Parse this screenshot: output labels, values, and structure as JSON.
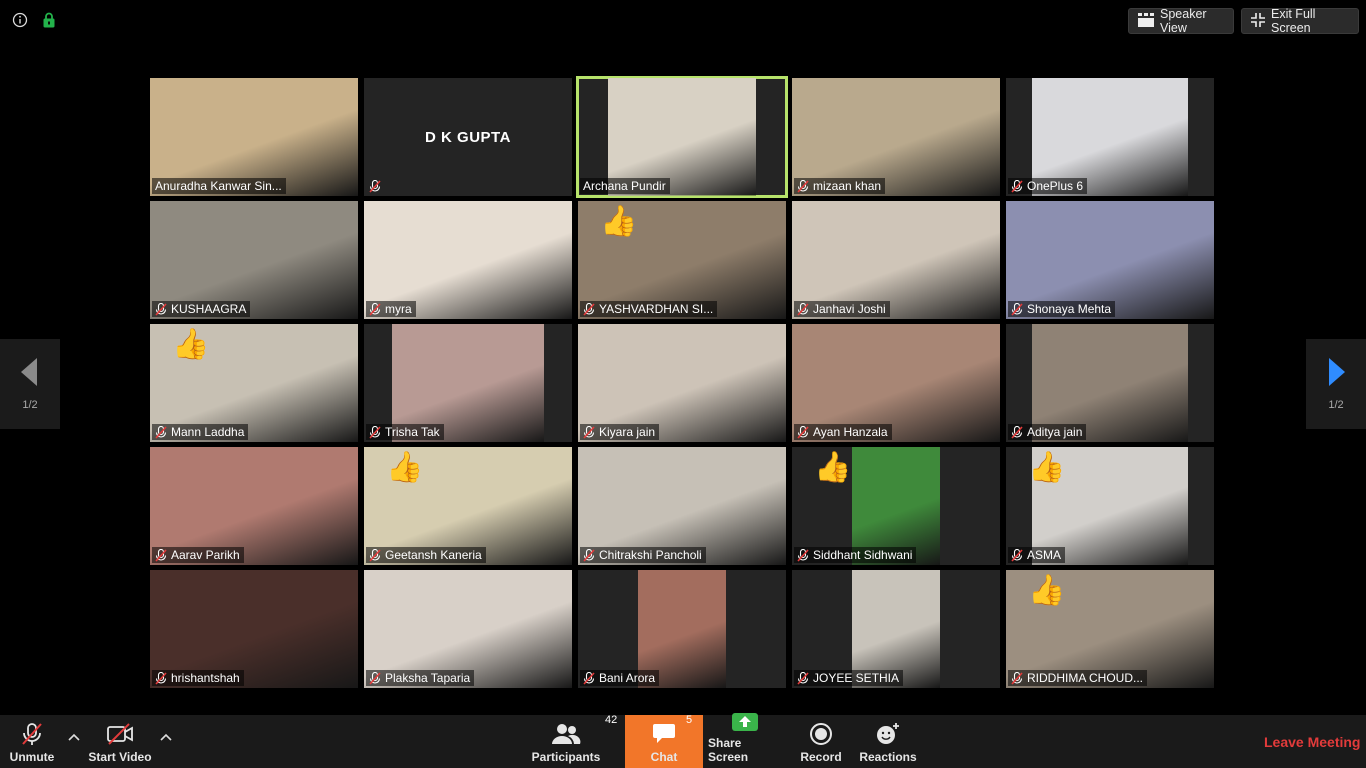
{
  "top": {
    "speaker_view": "Speaker View",
    "exit_full_screen": "Exit Full Screen"
  },
  "participants": [
    {
      "name": "Anuradha Kanwar Sin...",
      "video": true,
      "muted": false,
      "active": false,
      "reaction": "",
      "bg": "#c9b18a"
    },
    {
      "name": "D K GUPTA",
      "video": false,
      "muted": true,
      "active": false,
      "reaction": "",
      "bg": "#242424"
    },
    {
      "name": "Archana Pundir",
      "video": true,
      "muted": false,
      "active": true,
      "reaction": "",
      "bg": "#d8d1c4"
    },
    {
      "name": "mizaan khan",
      "video": true,
      "muted": true,
      "active": false,
      "reaction": "",
      "bg": "#b9a98d"
    },
    {
      "name": "OnePlus 6",
      "video": true,
      "muted": true,
      "active": false,
      "reaction": "",
      "bg": "#d9d9dc"
    },
    {
      "name": "KUSHAAGRA",
      "video": true,
      "muted": true,
      "active": false,
      "reaction": "",
      "bg": "#8f8a80"
    },
    {
      "name": "myra",
      "video": true,
      "muted": true,
      "active": false,
      "reaction": "",
      "bg": "#e6ddd2"
    },
    {
      "name": "YASHVARDHAN SI...",
      "video": true,
      "muted": true,
      "active": false,
      "reaction": "👍",
      "bg": "#8e7d6a"
    },
    {
      "name": "Janhavi Joshi",
      "video": true,
      "muted": true,
      "active": false,
      "reaction": "",
      "bg": "#cfc5b8"
    },
    {
      "name": "Shonaya Mehta",
      "video": true,
      "muted": true,
      "active": false,
      "reaction": "",
      "bg": "#8c8fb0"
    },
    {
      "name": "Mann Laddha",
      "video": true,
      "muted": true,
      "active": false,
      "reaction": "👍",
      "bg": "#c7c0b3"
    },
    {
      "name": "Trisha Tak",
      "video": true,
      "muted": true,
      "active": false,
      "reaction": "",
      "bg": "#b89a94"
    },
    {
      "name": "Kiyara jain",
      "video": true,
      "muted": true,
      "active": false,
      "reaction": "",
      "bg": "#cdc3b7"
    },
    {
      "name": "Ayan Hanzala",
      "video": true,
      "muted": true,
      "active": false,
      "reaction": "",
      "bg": "#a88675"
    },
    {
      "name": "Aditya jain",
      "video": true,
      "muted": true,
      "active": false,
      "reaction": "",
      "bg": "#8f8275"
    },
    {
      "name": "Aarav Parikh",
      "video": true,
      "muted": true,
      "active": false,
      "reaction": "",
      "bg": "#b07a70"
    },
    {
      "name": "Geetansh Kaneria",
      "video": true,
      "muted": true,
      "active": false,
      "reaction": "👍",
      "bg": "#d6cdb0"
    },
    {
      "name": "Chitrakshi Pancholi",
      "video": true,
      "muted": true,
      "active": false,
      "reaction": "",
      "bg": "#c6c0b6"
    },
    {
      "name": "Siddhant Sidhwani",
      "video": true,
      "muted": true,
      "active": false,
      "reaction": "👍",
      "bg": "#3f8a3b"
    },
    {
      "name": "ASMA",
      "video": true,
      "muted": true,
      "active": false,
      "reaction": "👍",
      "bg": "#d2cfcb"
    },
    {
      "name": "hrishantshah",
      "video": true,
      "muted": true,
      "active": false,
      "reaction": "",
      "bg": "#4a2f2a"
    },
    {
      "name": "Plaksha Taparia",
      "video": true,
      "muted": true,
      "active": false,
      "reaction": "",
      "bg": "#d8d0c8"
    },
    {
      "name": "Bani Arora",
      "video": true,
      "muted": true,
      "active": false,
      "reaction": "",
      "bg": "#a36d5e"
    },
    {
      "name": "JOYEE SETHIA",
      "video": true,
      "muted": true,
      "active": false,
      "reaction": "",
      "bg": "#c8c3ba"
    },
    {
      "name": "RIDDHIMA CHOUD...",
      "video": true,
      "muted": true,
      "active": false,
      "reaction": "👍",
      "bg": "#9c8f80"
    }
  ],
  "paging": {
    "left_label": "1/2",
    "right_label": "1/2"
  },
  "toolbar": {
    "unmute": "Unmute",
    "start_video": "Start Video",
    "participants": "Participants",
    "participants_count": "42",
    "chat": "Chat",
    "chat_count": "5",
    "share_screen": "Share Screen",
    "record": "Record",
    "reactions": "Reactions",
    "leave_meeting": "Leave Meeting"
  },
  "colors": {
    "accent_chat": "#f27629",
    "active_border": "#b7e36b",
    "leave": "#e23b3b",
    "share": "#3ab44a"
  }
}
